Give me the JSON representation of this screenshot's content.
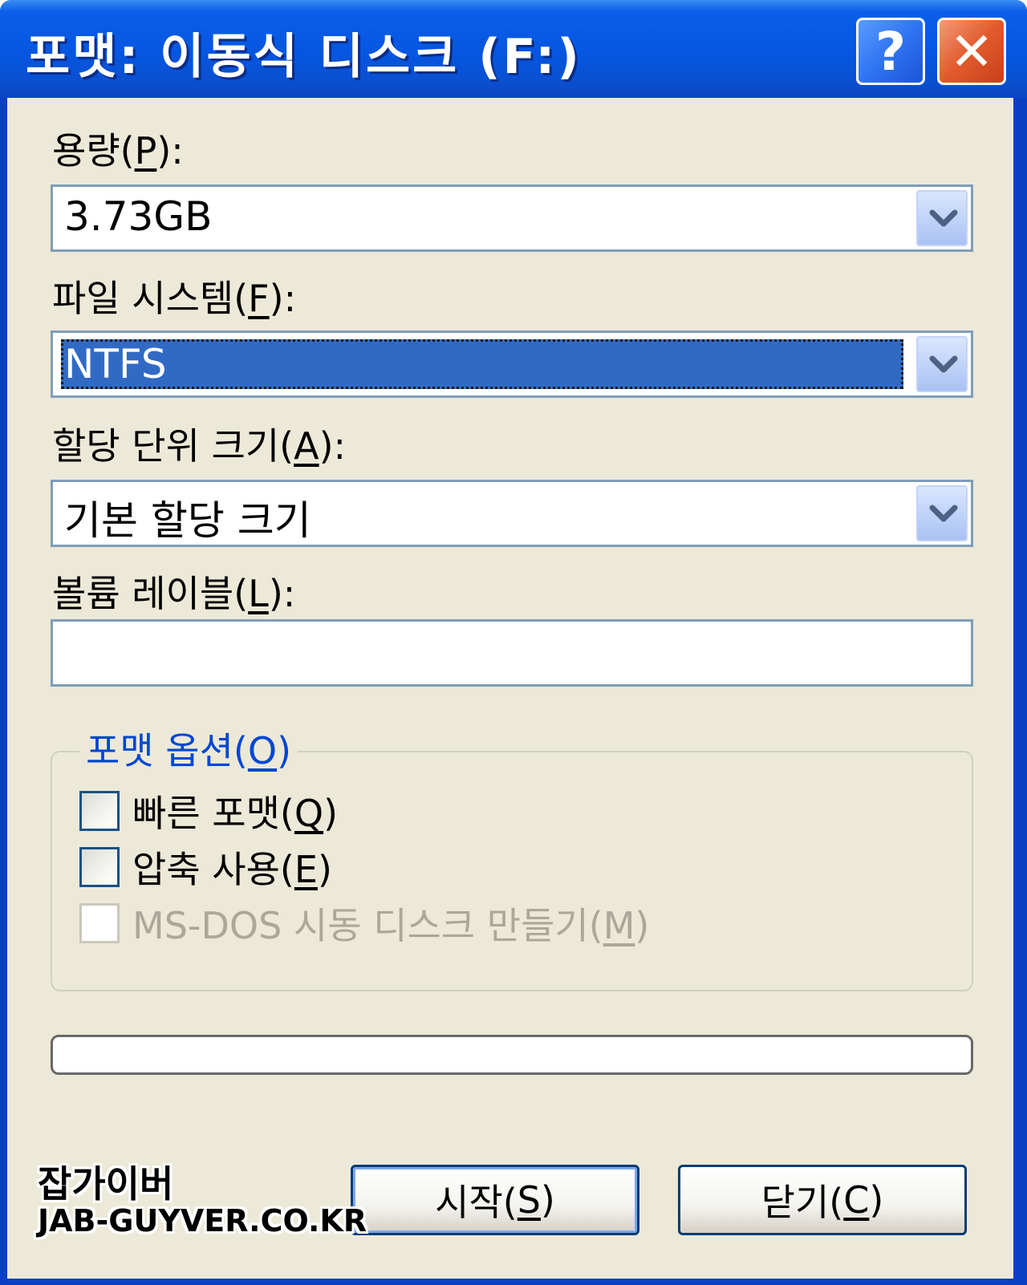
{
  "window": {
    "title": "포맷: 이동식 디스크 (F:)",
    "help_glyph": "?",
    "close_glyph": "✕"
  },
  "capacity": {
    "label_pre": "용량(",
    "label_key": "P",
    "label_post": "):",
    "value": "3.73GB"
  },
  "file_system": {
    "label_pre": "파일 시스템(",
    "label_key": "F",
    "label_post": "):",
    "value": "NTFS"
  },
  "allocation_unit": {
    "label_pre": "할당 단위 크기(",
    "label_key": "A",
    "label_post": "):",
    "value": "기본 할당 크기"
  },
  "volume_label": {
    "label_pre": "볼륨 레이블(",
    "label_key": "L",
    "label_post": "):",
    "value": ""
  },
  "format_options": {
    "legend_pre": "포맷 옵션(",
    "legend_key": "O",
    "legend_post": ")",
    "quick_format": {
      "label_pre": "빠른 포맷(",
      "key": "Q",
      "label_post": ")",
      "checked": false,
      "enabled": true
    },
    "compression": {
      "label_pre": "압축 사용(",
      "key": "E",
      "label_post": ")",
      "checked": false,
      "enabled": true
    },
    "msdos_startup": {
      "label_pre": "MS-DOS 시동 디스크 만들기(",
      "key": "M",
      "label_post": ")",
      "checked": false,
      "enabled": false
    }
  },
  "progress": {
    "value": 0
  },
  "buttons": {
    "start": {
      "label_pre": "시작(",
      "key": "S",
      "label_post": ")"
    },
    "close": {
      "label_pre": "닫기(",
      "key": "C",
      "label_post": ")"
    }
  },
  "watermark": {
    "line1": "잡가이버",
    "line2": "JAB-GUYVER.CO.KR"
  },
  "colors": {
    "title_bar": "#0656e0",
    "dialog_bg": "#ece9d8",
    "selection": "#316ac5",
    "group_legend": "#0046d5",
    "close_button": "#e25a2c"
  }
}
